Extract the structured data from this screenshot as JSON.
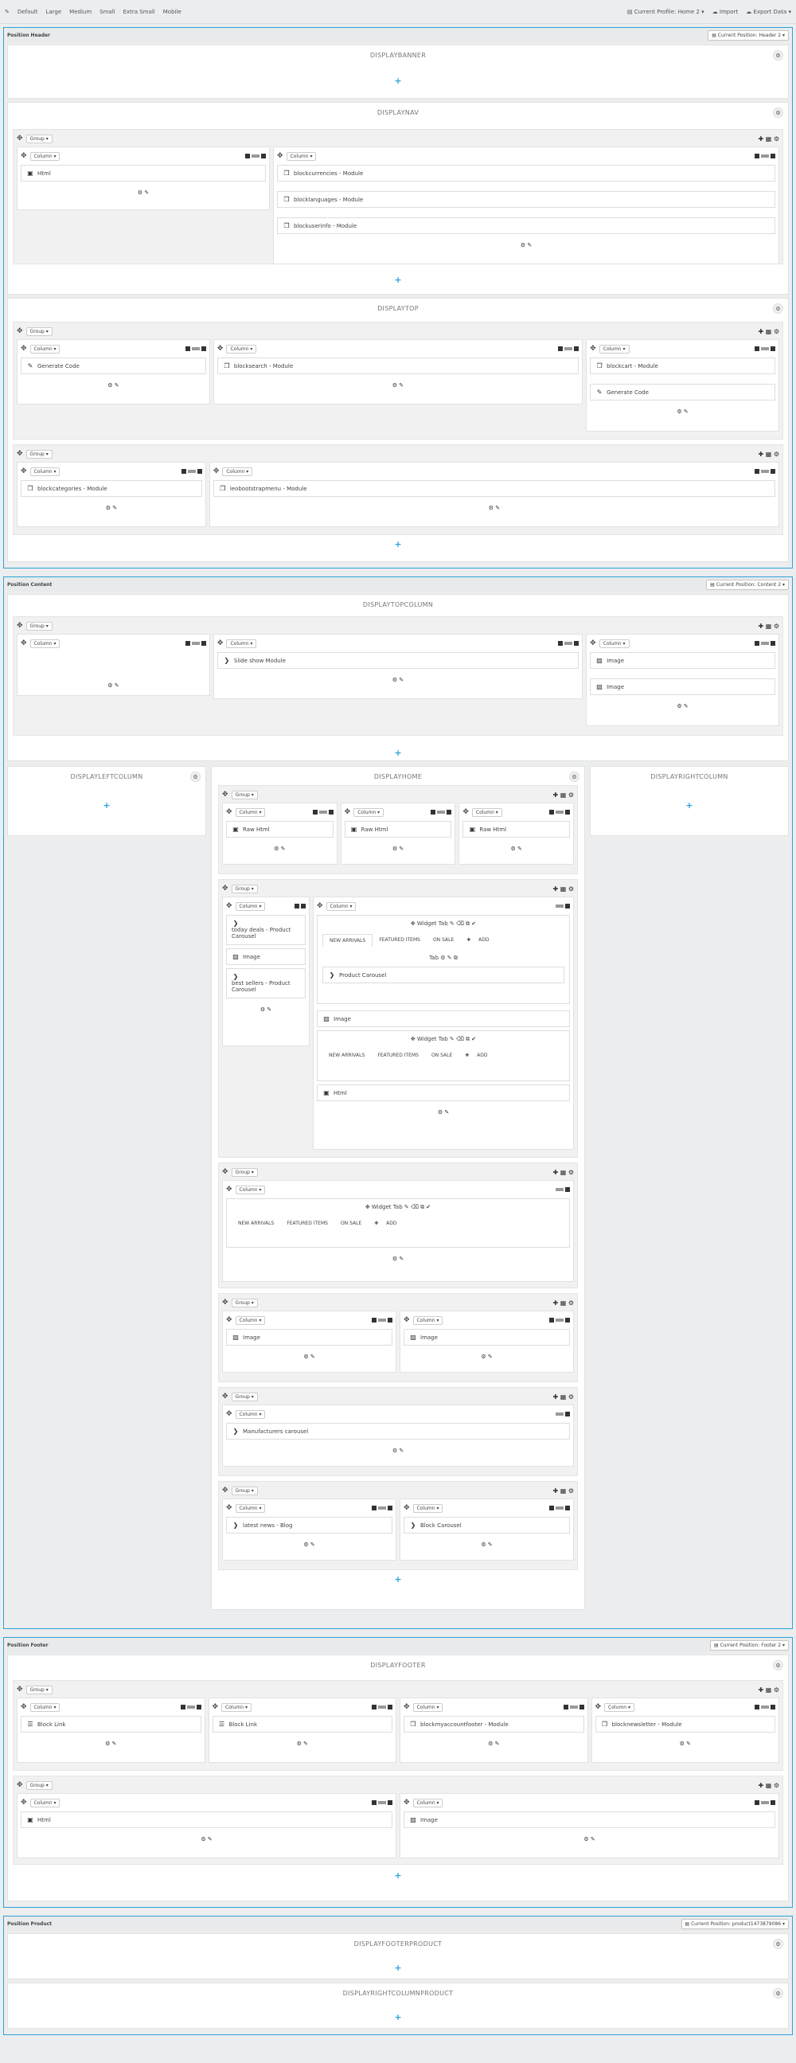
{
  "toolbar": {
    "edit_icon": "pencil-icon",
    "devices": [
      "Default",
      "Large",
      "Medium",
      "Small",
      "Extra Small",
      "Mobile"
    ],
    "profile": "Current Profile: Home 2",
    "import": "Import",
    "export": "Export Data"
  },
  "header": {
    "title": "Position Header",
    "current": "Current Position: Header 2",
    "displaybanner": "DISPLAYBANNER",
    "displaynav": "DISPLAYNAV",
    "displaytop": "DISPLAYTOP",
    "group_label": "Group",
    "column_label": "Column",
    "nav_modules_left": [
      "Html"
    ],
    "nav_modules_right": [
      "blockcurrencies - Module",
      "blocklanguages - Module",
      "blockuserinfo - Module"
    ],
    "top_g1": [
      [
        "Generate Code"
      ],
      [
        "blocksearch - Module"
      ],
      [
        "blockcart - Module",
        "Generate Code"
      ]
    ],
    "top_g2": [
      [
        "blockcategories - Module"
      ],
      [
        "leobootstrapmenu - Module"
      ]
    ]
  },
  "content": {
    "title": "Position Content",
    "current": "Current Position: Content 2",
    "displaytopcolumn": "DISPLAYTOPCOLUMN",
    "topcol_modules": [
      [],
      [
        "Slide show Module"
      ],
      [
        "Image",
        "Image"
      ]
    ],
    "displayleftcolumn": "DISPLAYLEFTCOLUMN",
    "displayhome": "DISPLAYHOME",
    "displayrightcolumn": "DISPLAYRIGHTCOLUMN",
    "home_g1": [
      "Raw Html",
      "Raw Html",
      "Raw Html"
    ],
    "home_g2_left": [
      "today deals - Product Carousel",
      "Image",
      "best sellers - Product Carousel"
    ],
    "widget_tab": "Widget Tab",
    "tabs": [
      "NEW ARRIVALS",
      "FEATURED ITEMS",
      "ON SALE",
      "ADD"
    ],
    "tab_label": "Tab",
    "product_carousel": "Product Carousel",
    "image": "Image",
    "html": "Html",
    "home_g4": [
      "Image",
      "Image"
    ],
    "manufacturers": "Manufacturers carousel",
    "home_g6": [
      "latest news - Blog",
      "Block Carousel"
    ]
  },
  "footer": {
    "title": "Position Footer",
    "current": "Current Position: Footer 2",
    "displayfooter": "DISPLAYFOOTER",
    "g1": [
      "Block Link",
      "Block Link",
      "blockmyaccountfooter - Module",
      "blocknewsletter - Module"
    ],
    "g2": [
      "Html",
      "Image"
    ]
  },
  "product": {
    "title": "Position Product",
    "current": "Current Position: product1473879086",
    "displayfooterproduct": "DISPLAYFOOTERPRODUCT",
    "displayrightcolumnproduct": "DISPLAYRIGHTCOLUMNPRODUCT"
  }
}
